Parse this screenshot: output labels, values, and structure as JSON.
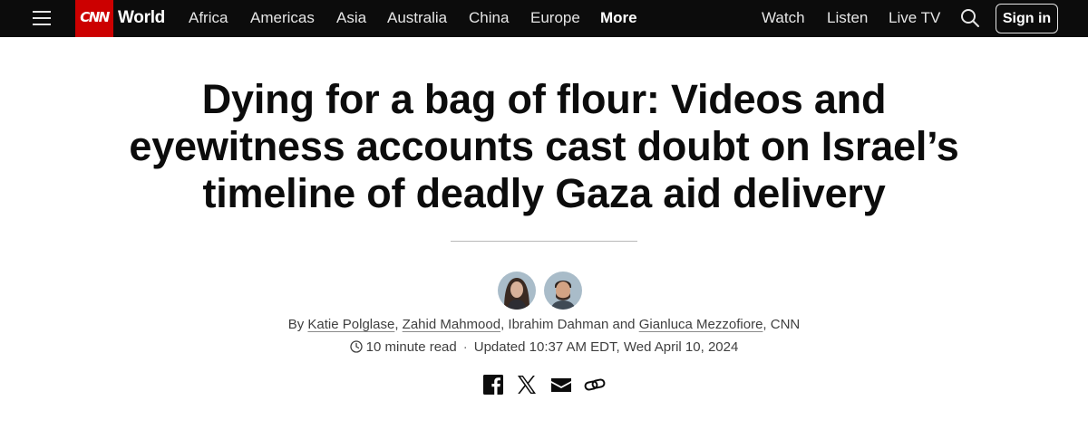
{
  "header": {
    "logo": "CNN",
    "section": "World",
    "nav": [
      "Africa",
      "Americas",
      "Asia",
      "Australia",
      "China",
      "Europe",
      "More"
    ],
    "right_links": [
      "Watch",
      "Listen",
      "Live TV"
    ],
    "sign_in": "Sign in",
    "icons": [
      "menu-icon",
      "search-icon"
    ]
  },
  "article": {
    "headline": "Dying for a bag of flour: Videos and eyewitness accounts cast doubt on Israel’s timeline of deadly Gaza aid delivery",
    "byline": {
      "prefix": "By",
      "authors": [
        {
          "name": "Katie Polglase",
          "linked": true
        },
        {
          "name": "Zahid Mahmood",
          "linked": true
        },
        {
          "name": "Ibrahim Dahman",
          "linked": false
        },
        {
          "name": "Gianluca Mezzofiore",
          "linked": true
        }
      ],
      "sep_comma": ",",
      "sep_and": "and",
      "outlet": "CNN"
    },
    "read_time": "10 minute read",
    "dot": "·",
    "updated": "Updated 10:37 AM EDT, Wed April 10, 2024",
    "share_icons": [
      "facebook-icon",
      "x-icon",
      "email-icon",
      "link-icon"
    ]
  },
  "colors": {
    "topbar": "#0c0c0c",
    "brand": "#cc0000",
    "text": "#0c0c0c",
    "meta": "#404040"
  }
}
